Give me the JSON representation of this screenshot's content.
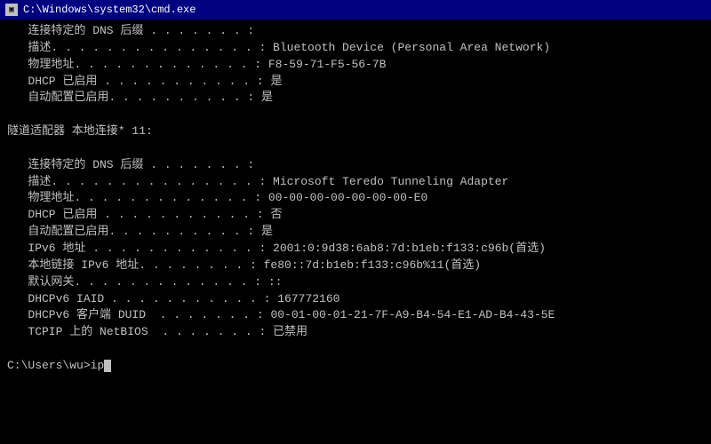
{
  "titleBar": {
    "icon": "▣",
    "title": "C:\\Windows\\system32\\cmd.exe"
  },
  "terminal": {
    "lines": [
      "   连接特定的 DNS 后缀 . . . . . . . :",
      "   描述. . . . . . . . . . . . . . . : Bluetooth Device (Personal Area Network)",
      "   物理地址. . . . . . . . . . . . . : F8-59-71-F5-56-7B",
      "   DHCP 已启用 . . . . . . . . . . . : 是",
      "   自动配置已启用. . . . . . . . . . : 是",
      "",
      "隧道适配器 本地连接* 11:",
      "",
      "   连接特定的 DNS 后缀 . . . . . . . :",
      "   描述. . . . . . . . . . . . . . . : Microsoft Teredo Tunneling Adapter",
      "   物理地址. . . . . . . . . . . . . : 00-00-00-00-00-00-00-E0",
      "   DHCP 已启用 . . . . . . . . . . . : 否",
      "   自动配置已启用. . . . . . . . . . : 是",
      "   IPv6 地址 . . . . . . . . . . . . : 2001:0:9d38:6ab8:7d:b1eb:f133:c96b(首选)",
      "   本地链接 IPv6 地址. . . . . . . . : fe80::7d:b1eb:f133:c96b%11(首选)",
      "   默认网关. . . . . . . . . . . . . : ::",
      "   DHCPv6 IAID . . . . . . . . . . . : 167772160",
      "   DHCPv6 客户端 DUID  . . . . . . . : 00-01-00-01-21-7F-A9-B4-54-E1-AD-B4-43-5E",
      "   TCPIP 上的 NetBIOS  . . . . . . . : 已禁用",
      "",
      "C:\\Users\\wu>ip"
    ],
    "prompt": "C:\\Users\\wu>ip"
  }
}
